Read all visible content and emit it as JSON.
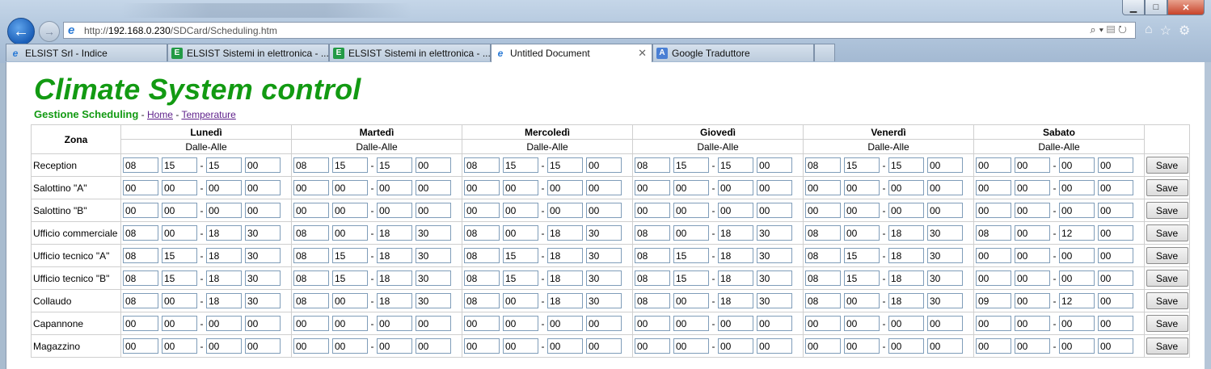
{
  "browser": {
    "url_prefix": "http://",
    "url_host": "192.168.0.230",
    "url_path": "/SDCard/Scheduling.htm",
    "tabs": [
      {
        "label": "ELSIST Srl - Indice",
        "icon": "ie-icon",
        "active": false
      },
      {
        "label": "ELSIST Sistemi in elettronica - ...",
        "icon": "elsist-icon",
        "active": false
      },
      {
        "label": "ELSIST Sistemi in elettronica - ...",
        "icon": "elsist-icon",
        "active": false
      },
      {
        "label": "Untitled Document",
        "icon": "ie-icon",
        "active": true
      },
      {
        "label": "Google Traduttore",
        "icon": "translate-icon",
        "active": false
      }
    ]
  },
  "page": {
    "title": "Climate System control",
    "section": "Gestione Scheduling",
    "sep1": " - ",
    "link_home": "Home",
    "sep2": " - ",
    "link_temperature": "Temperature"
  },
  "table": {
    "zone_header": "Zona",
    "range_label": "Dalle-Alle",
    "dash": "-",
    "save_label": "Save",
    "days": [
      "Lunedì",
      "Martedì",
      "Mercoledì",
      "Giovedì",
      "Venerdì",
      "Sabato"
    ],
    "rows": [
      {
        "zone": "Reception",
        "values": [
          [
            "08",
            "15",
            "15",
            "00"
          ],
          [
            "08",
            "15",
            "15",
            "00"
          ],
          [
            "08",
            "15",
            "15",
            "00"
          ],
          [
            "08",
            "15",
            "15",
            "00"
          ],
          [
            "08",
            "15",
            "15",
            "00"
          ],
          [
            "00",
            "00",
            "00",
            "00"
          ]
        ]
      },
      {
        "zone": "Salottino \"A\"",
        "values": [
          [
            "00",
            "00",
            "00",
            "00"
          ],
          [
            "00",
            "00",
            "00",
            "00"
          ],
          [
            "00",
            "00",
            "00",
            "00"
          ],
          [
            "00",
            "00",
            "00",
            "00"
          ],
          [
            "00",
            "00",
            "00",
            "00"
          ],
          [
            "00",
            "00",
            "00",
            "00"
          ]
        ]
      },
      {
        "zone": "Salottino \"B\"",
        "values": [
          [
            "00",
            "00",
            "00",
            "00"
          ],
          [
            "00",
            "00",
            "00",
            "00"
          ],
          [
            "00",
            "00",
            "00",
            "00"
          ],
          [
            "00",
            "00",
            "00",
            "00"
          ],
          [
            "00",
            "00",
            "00",
            "00"
          ],
          [
            "00",
            "00",
            "00",
            "00"
          ]
        ]
      },
      {
        "zone": "Ufficio commerciale",
        "values": [
          [
            "08",
            "00",
            "18",
            "30"
          ],
          [
            "08",
            "00",
            "18",
            "30"
          ],
          [
            "08",
            "00",
            "18",
            "30"
          ],
          [
            "08",
            "00",
            "18",
            "30"
          ],
          [
            "08",
            "00",
            "18",
            "30"
          ],
          [
            "08",
            "00",
            "12",
            "00"
          ]
        ]
      },
      {
        "zone": "Ufficio tecnico \"A\"",
        "values": [
          [
            "08",
            "15",
            "18",
            "30"
          ],
          [
            "08",
            "15",
            "18",
            "30"
          ],
          [
            "08",
            "15",
            "18",
            "30"
          ],
          [
            "08",
            "15",
            "18",
            "30"
          ],
          [
            "08",
            "15",
            "18",
            "30"
          ],
          [
            "00",
            "00",
            "00",
            "00"
          ]
        ]
      },
      {
        "zone": "Ufficio tecnico \"B\"",
        "values": [
          [
            "08",
            "15",
            "18",
            "30"
          ],
          [
            "08",
            "15",
            "18",
            "30"
          ],
          [
            "08",
            "15",
            "18",
            "30"
          ],
          [
            "08",
            "15",
            "18",
            "30"
          ],
          [
            "08",
            "15",
            "18",
            "30"
          ],
          [
            "00",
            "00",
            "00",
            "00"
          ]
        ]
      },
      {
        "zone": "Collaudo",
        "values": [
          [
            "08",
            "00",
            "18",
            "30"
          ],
          [
            "08",
            "00",
            "18",
            "30"
          ],
          [
            "08",
            "00",
            "18",
            "30"
          ],
          [
            "08",
            "00",
            "18",
            "30"
          ],
          [
            "08",
            "00",
            "18",
            "30"
          ],
          [
            "09",
            "00",
            "12",
            "00"
          ]
        ]
      },
      {
        "zone": "Capannone",
        "values": [
          [
            "00",
            "00",
            "00",
            "00"
          ],
          [
            "00",
            "00",
            "00",
            "00"
          ],
          [
            "00",
            "00",
            "00",
            "00"
          ],
          [
            "00",
            "00",
            "00",
            "00"
          ],
          [
            "00",
            "00",
            "00",
            "00"
          ],
          [
            "00",
            "00",
            "00",
            "00"
          ]
        ]
      },
      {
        "zone": "Magazzino",
        "values": [
          [
            "00",
            "00",
            "00",
            "00"
          ],
          [
            "00",
            "00",
            "00",
            "00"
          ],
          [
            "00",
            "00",
            "00",
            "00"
          ],
          [
            "00",
            "00",
            "00",
            "00"
          ],
          [
            "00",
            "00",
            "00",
            "00"
          ],
          [
            "00",
            "00",
            "00",
            "00"
          ]
        ]
      }
    ]
  }
}
